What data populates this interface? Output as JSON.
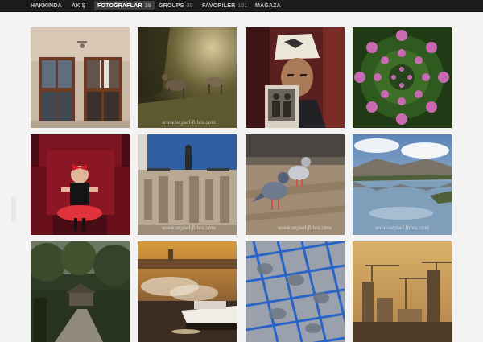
{
  "nav": {
    "items": [
      {
        "label": "HAKKINDA",
        "count": null,
        "active": false
      },
      {
        "label": "AKIŞ",
        "count": null,
        "active": false
      },
      {
        "label": "FOTOĞRAFLAR",
        "count": "39",
        "active": true
      },
      {
        "label": "GROUPS",
        "count": "30",
        "active": false
      },
      {
        "label": "FAVORILER",
        "count": "101",
        "active": false
      },
      {
        "label": "MAĞAZA",
        "count": null,
        "active": false
      }
    ]
  },
  "gallery": {
    "photos": [
      {
        "subject": "windows on a facade",
        "watermark": ""
      },
      {
        "subject": "deer at dusk",
        "watermark": "www.veysel-fotos.com"
      },
      {
        "subject": "old man holding photograph",
        "watermark": ""
      },
      {
        "subject": "pink flower kaleidoscope",
        "watermark": ""
      },
      {
        "subject": "girl in red armchair",
        "watermark": ""
      },
      {
        "subject": "statue on stone relief",
        "watermark": "www.veysel-fotos.com"
      },
      {
        "subject": "pigeons on pavement",
        "watermark": "www.veysel-fotos.com"
      },
      {
        "subject": "lake and mountains reflection",
        "watermark": "www.veysel-fotos.com"
      },
      {
        "subject": "cottage in forest",
        "watermark": ""
      },
      {
        "subject": "harbour at sunset",
        "watermark": ""
      },
      {
        "subject": "blue cage with pigeons",
        "watermark": ""
      },
      {
        "subject": "construction cranes at dusk",
        "watermark": ""
      }
    ]
  }
}
